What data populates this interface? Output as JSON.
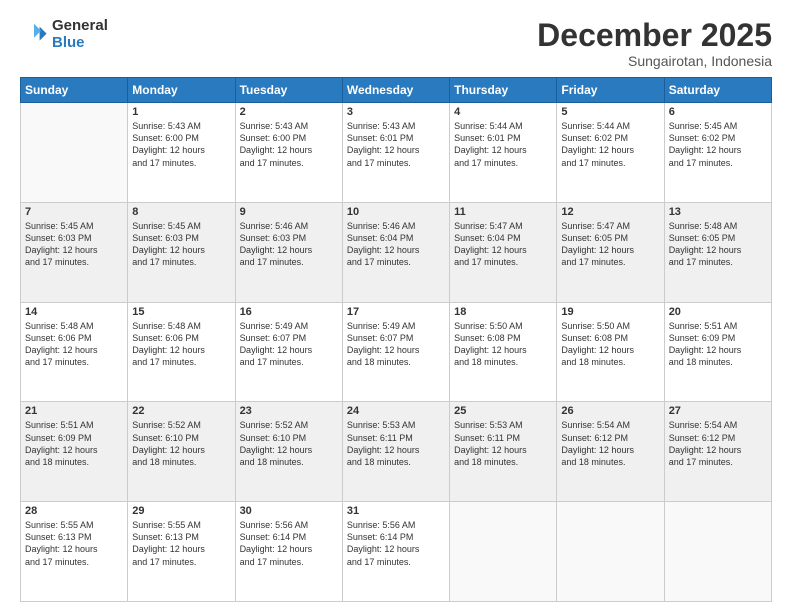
{
  "logo": {
    "general": "General",
    "blue": "Blue"
  },
  "header": {
    "title": "December 2025",
    "subtitle": "Sungairotan, Indonesia"
  },
  "weekdays": [
    "Sunday",
    "Monday",
    "Tuesday",
    "Wednesday",
    "Thursday",
    "Friday",
    "Saturday"
  ],
  "weeks": [
    [
      {
        "day": "",
        "info": ""
      },
      {
        "day": "1",
        "info": "Sunrise: 5:43 AM\nSunset: 6:00 PM\nDaylight: 12 hours\nand 17 minutes."
      },
      {
        "day": "2",
        "info": "Sunrise: 5:43 AM\nSunset: 6:00 PM\nDaylight: 12 hours\nand 17 minutes."
      },
      {
        "day": "3",
        "info": "Sunrise: 5:43 AM\nSunset: 6:01 PM\nDaylight: 12 hours\nand 17 minutes."
      },
      {
        "day": "4",
        "info": "Sunrise: 5:44 AM\nSunset: 6:01 PM\nDaylight: 12 hours\nand 17 minutes."
      },
      {
        "day": "5",
        "info": "Sunrise: 5:44 AM\nSunset: 6:02 PM\nDaylight: 12 hours\nand 17 minutes."
      },
      {
        "day": "6",
        "info": "Sunrise: 5:45 AM\nSunset: 6:02 PM\nDaylight: 12 hours\nand 17 minutes."
      }
    ],
    [
      {
        "day": "7",
        "info": "Sunrise: 5:45 AM\nSunset: 6:03 PM\nDaylight: 12 hours\nand 17 minutes."
      },
      {
        "day": "8",
        "info": "Sunrise: 5:45 AM\nSunset: 6:03 PM\nDaylight: 12 hours\nand 17 minutes."
      },
      {
        "day": "9",
        "info": "Sunrise: 5:46 AM\nSunset: 6:03 PM\nDaylight: 12 hours\nand 17 minutes."
      },
      {
        "day": "10",
        "info": "Sunrise: 5:46 AM\nSunset: 6:04 PM\nDaylight: 12 hours\nand 17 minutes."
      },
      {
        "day": "11",
        "info": "Sunrise: 5:47 AM\nSunset: 6:04 PM\nDaylight: 12 hours\nand 17 minutes."
      },
      {
        "day": "12",
        "info": "Sunrise: 5:47 AM\nSunset: 6:05 PM\nDaylight: 12 hours\nand 17 minutes."
      },
      {
        "day": "13",
        "info": "Sunrise: 5:48 AM\nSunset: 6:05 PM\nDaylight: 12 hours\nand 17 minutes."
      }
    ],
    [
      {
        "day": "14",
        "info": "Sunrise: 5:48 AM\nSunset: 6:06 PM\nDaylight: 12 hours\nand 17 minutes."
      },
      {
        "day": "15",
        "info": "Sunrise: 5:48 AM\nSunset: 6:06 PM\nDaylight: 12 hours\nand 17 minutes."
      },
      {
        "day": "16",
        "info": "Sunrise: 5:49 AM\nSunset: 6:07 PM\nDaylight: 12 hours\nand 17 minutes."
      },
      {
        "day": "17",
        "info": "Sunrise: 5:49 AM\nSunset: 6:07 PM\nDaylight: 12 hours\nand 18 minutes."
      },
      {
        "day": "18",
        "info": "Sunrise: 5:50 AM\nSunset: 6:08 PM\nDaylight: 12 hours\nand 18 minutes."
      },
      {
        "day": "19",
        "info": "Sunrise: 5:50 AM\nSunset: 6:08 PM\nDaylight: 12 hours\nand 18 minutes."
      },
      {
        "day": "20",
        "info": "Sunrise: 5:51 AM\nSunset: 6:09 PM\nDaylight: 12 hours\nand 18 minutes."
      }
    ],
    [
      {
        "day": "21",
        "info": "Sunrise: 5:51 AM\nSunset: 6:09 PM\nDaylight: 12 hours\nand 18 minutes."
      },
      {
        "day": "22",
        "info": "Sunrise: 5:52 AM\nSunset: 6:10 PM\nDaylight: 12 hours\nand 18 minutes."
      },
      {
        "day": "23",
        "info": "Sunrise: 5:52 AM\nSunset: 6:10 PM\nDaylight: 12 hours\nand 18 minutes."
      },
      {
        "day": "24",
        "info": "Sunrise: 5:53 AM\nSunset: 6:11 PM\nDaylight: 12 hours\nand 18 minutes."
      },
      {
        "day": "25",
        "info": "Sunrise: 5:53 AM\nSunset: 6:11 PM\nDaylight: 12 hours\nand 18 minutes."
      },
      {
        "day": "26",
        "info": "Sunrise: 5:54 AM\nSunset: 6:12 PM\nDaylight: 12 hours\nand 18 minutes."
      },
      {
        "day": "27",
        "info": "Sunrise: 5:54 AM\nSunset: 6:12 PM\nDaylight: 12 hours\nand 17 minutes."
      }
    ],
    [
      {
        "day": "28",
        "info": "Sunrise: 5:55 AM\nSunset: 6:13 PM\nDaylight: 12 hours\nand 17 minutes."
      },
      {
        "day": "29",
        "info": "Sunrise: 5:55 AM\nSunset: 6:13 PM\nDaylight: 12 hours\nand 17 minutes."
      },
      {
        "day": "30",
        "info": "Sunrise: 5:56 AM\nSunset: 6:14 PM\nDaylight: 12 hours\nand 17 minutes."
      },
      {
        "day": "31",
        "info": "Sunrise: 5:56 AM\nSunset: 6:14 PM\nDaylight: 12 hours\nand 17 minutes."
      },
      {
        "day": "",
        "info": ""
      },
      {
        "day": "",
        "info": ""
      },
      {
        "day": "",
        "info": ""
      }
    ]
  ]
}
